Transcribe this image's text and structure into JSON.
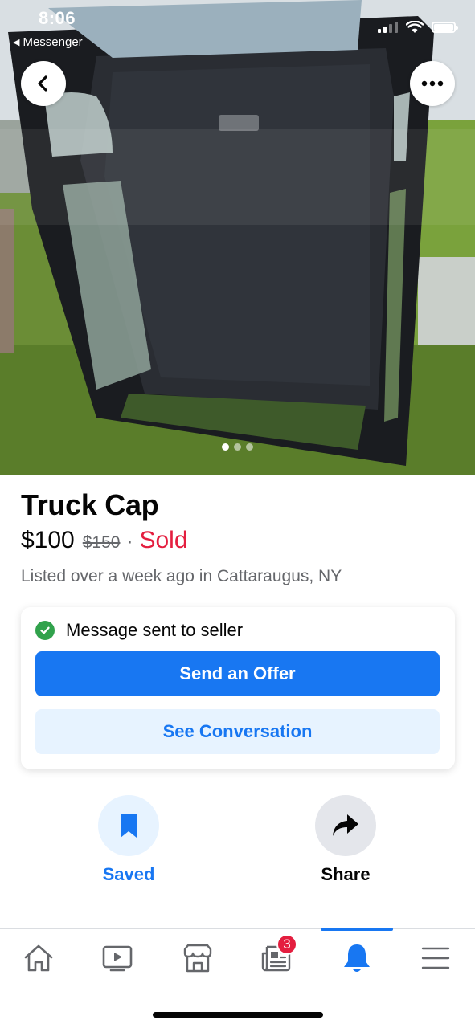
{
  "status_bar": {
    "time": "8:06",
    "back_app": "Messenger"
  },
  "header": {
    "back_icon": "chevron-left-icon",
    "more_icon": "more-horizontal-icon"
  },
  "photo": {
    "total_images": 3,
    "current_image": 1
  },
  "listing": {
    "title": "Truck Cap",
    "price": "$100",
    "original_price": "$150",
    "separator": "·",
    "status": "Sold",
    "listed": "Listed over a week ago in Cattaraugus, NY"
  },
  "message_card": {
    "sent_text": "Message sent to seller",
    "offer_button": "Send an Offer",
    "conversation_button": "See Conversation"
  },
  "actions": {
    "saved_label": "Saved",
    "share_label": "Share"
  },
  "bottom_nav": {
    "items": [
      {
        "icon": "home-icon"
      },
      {
        "icon": "video-icon"
      },
      {
        "icon": "marketplace-icon"
      },
      {
        "icon": "news-icon",
        "badge": "3"
      },
      {
        "icon": "bell-icon",
        "active": true
      },
      {
        "icon": "menu-icon"
      }
    ]
  },
  "colors": {
    "accent": "#1877f2",
    "sold": "#e41e3f",
    "success": "#31a24c",
    "secondary_text": "#65676b"
  }
}
